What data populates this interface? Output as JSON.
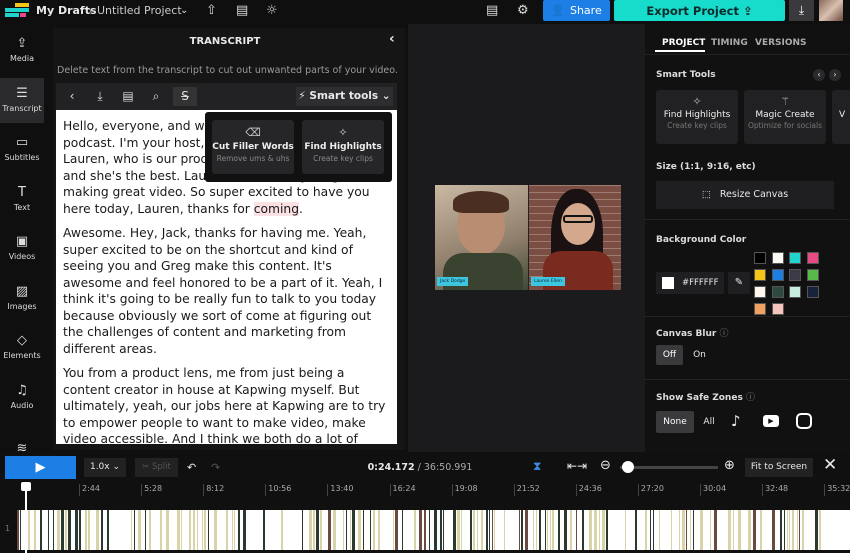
{
  "header": {
    "breadcrumb_root": "My Drafts",
    "breadcrumb_sep": "›",
    "project_title": "Untitled Project",
    "share_label": "Share",
    "export_label": "Export Project",
    "icons": [
      "upload-icon",
      "subtitle-icon",
      "lightbulb-icon",
      "comment-icon",
      "gear-icon",
      "download-icon"
    ]
  },
  "sidebar": {
    "items": [
      {
        "label": "Media",
        "icon": "⇪"
      },
      {
        "label": "Transcript",
        "icon": "☰"
      },
      {
        "label": "Subtitles",
        "icon": "▭"
      },
      {
        "label": "Text",
        "icon": "T"
      },
      {
        "label": "Videos",
        "icon": "▣"
      },
      {
        "label": "Images",
        "icon": "▨"
      },
      {
        "label": "Elements",
        "icon": "◇"
      },
      {
        "label": "Audio",
        "icon": "♫"
      }
    ]
  },
  "transcript": {
    "title": "TRANSCRIPT",
    "description": "Delete text from the transcript to cut out unwanted parts of your video.",
    "smart_tools_label": "Smart tools",
    "paragraphs": [
      {
        "text": "Hello, everyone, and welcome to the Kapwing podcast. I'm your host, Jack, and today I'm joined by Lauren, who is our product lead here at Kapwing, and she's the best. Lauren knows everything about making great video. So super excited to have you here today, Lauren, thanks for ",
        "highlight": "coming",
        "after": "."
      },
      {
        "text": "Awesome. Hey, Jack, thanks for having me. Yeah, super excited to be on the shortcut and kind of seeing you and Greg make this content. It's awesome and feel honored to be a part of it. Yeah, I think it's going to be really fun to talk to you today because obviously we sort of come at figuring out the challenges of content and marketing from different areas."
      },
      {
        "text": "You from a product lens, me from just being a content creator in house at Kapwing myself. But ultimately, yeah, our jobs here at Kapwing are to try to empower people to want to make video, make video accessible. And I think we both do a lot of thinking about that."
      }
    ],
    "popup": [
      {
        "title": "Cut Filler Words",
        "subtitle": "Remove ums & uhs",
        "icon": "eraser-icon"
      },
      {
        "title": "Find Highlights",
        "subtitle": "Create key clips",
        "icon": "sparkle-icon"
      }
    ]
  },
  "canvas": {
    "speaker_left": "Jack Dodge",
    "speaker_right": "Lauren Ellen"
  },
  "right_panel": {
    "tabs": [
      "PROJECT",
      "TIMING",
      "VERSIONS"
    ],
    "active_tab": "PROJECT",
    "smart_tools_label": "Smart Tools",
    "cards": [
      {
        "title": "Find Highlights",
        "subtitle": "Create key clips"
      },
      {
        "title": "Magic Create",
        "subtitle": "Optimize for socials"
      },
      {
        "title": "V",
        "subtitle": ""
      }
    ],
    "size_label": "Size (1:1, 9:16, etc)",
    "resize_label": "Resize Canvas",
    "bg_label": "Background Color",
    "bg_value": "#FFFFFF",
    "swatches": [
      "#000000",
      "#fdfaf5",
      "#20d3cc",
      "#e84a84",
      "#f5c518",
      "#1d7fe6",
      "#3b3a45",
      "#58b84a",
      "#fbf7ee",
      "#2c4a40",
      "#c8eee0",
      "#16233a",
      "#f0a060",
      "#f5c4bc"
    ],
    "blur_label": "Canvas Blur",
    "blur_options": [
      "Off",
      "On"
    ],
    "blur_value": "Off",
    "safe_label": "Show Safe Zones",
    "safe_options": [
      "None",
      "All"
    ],
    "safe_value": "None",
    "safe_icons": [
      "tiktok-icon",
      "youtube-icon",
      "instagram-icon"
    ]
  },
  "timeline": {
    "speed": "1.0x",
    "split_label": "Split",
    "current_time": "0:24.172",
    "total_time": "/ 36:50.991",
    "fit_label": "Fit to Screen",
    "track_number": "1",
    "ticks": [
      "2:44",
      "5:28",
      "8:12",
      "10:56",
      "13:40",
      "16:24",
      "19:08",
      "21:52",
      "24:36",
      "27:20",
      "30:04",
      "32:48",
      "35:32"
    ],
    "zoom_level": 0.05
  }
}
